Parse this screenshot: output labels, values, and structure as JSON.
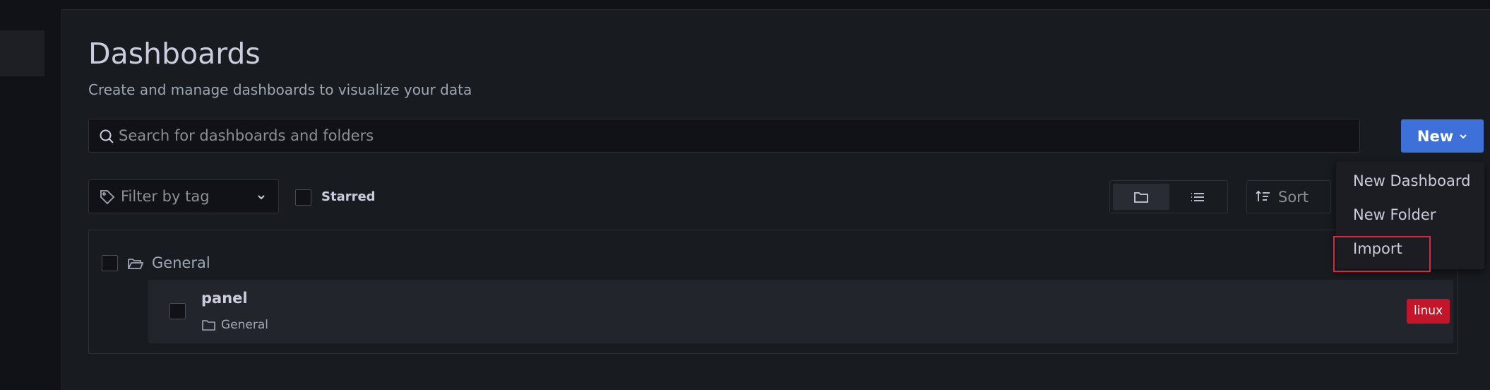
{
  "header": {
    "title": "Dashboards",
    "subtitle": "Create and manage dashboards to visualize your data"
  },
  "search": {
    "placeholder": "Search for dashboards and folders",
    "value": ""
  },
  "new_button": {
    "label": "New"
  },
  "new_menu": {
    "items": [
      {
        "label": "New Dashboard"
      },
      {
        "label": "New Folder"
      },
      {
        "label": "Import"
      }
    ]
  },
  "filters": {
    "tag_placeholder": "Filter by tag",
    "starred_label": "Starred",
    "starred_checked": false,
    "sort_label": "Sort",
    "view_mode": "folders"
  },
  "results": {
    "folders": [
      {
        "name": "General",
        "dashboards": [
          {
            "title": "panel",
            "folder": "General",
            "tags": [
              "linux"
            ]
          }
        ]
      }
    ]
  },
  "colors": {
    "background": "#111217",
    "panel": "#181b1f",
    "primary": "#3d71d9",
    "tag_linux": "#c4162a",
    "highlight": "#d9283f"
  }
}
